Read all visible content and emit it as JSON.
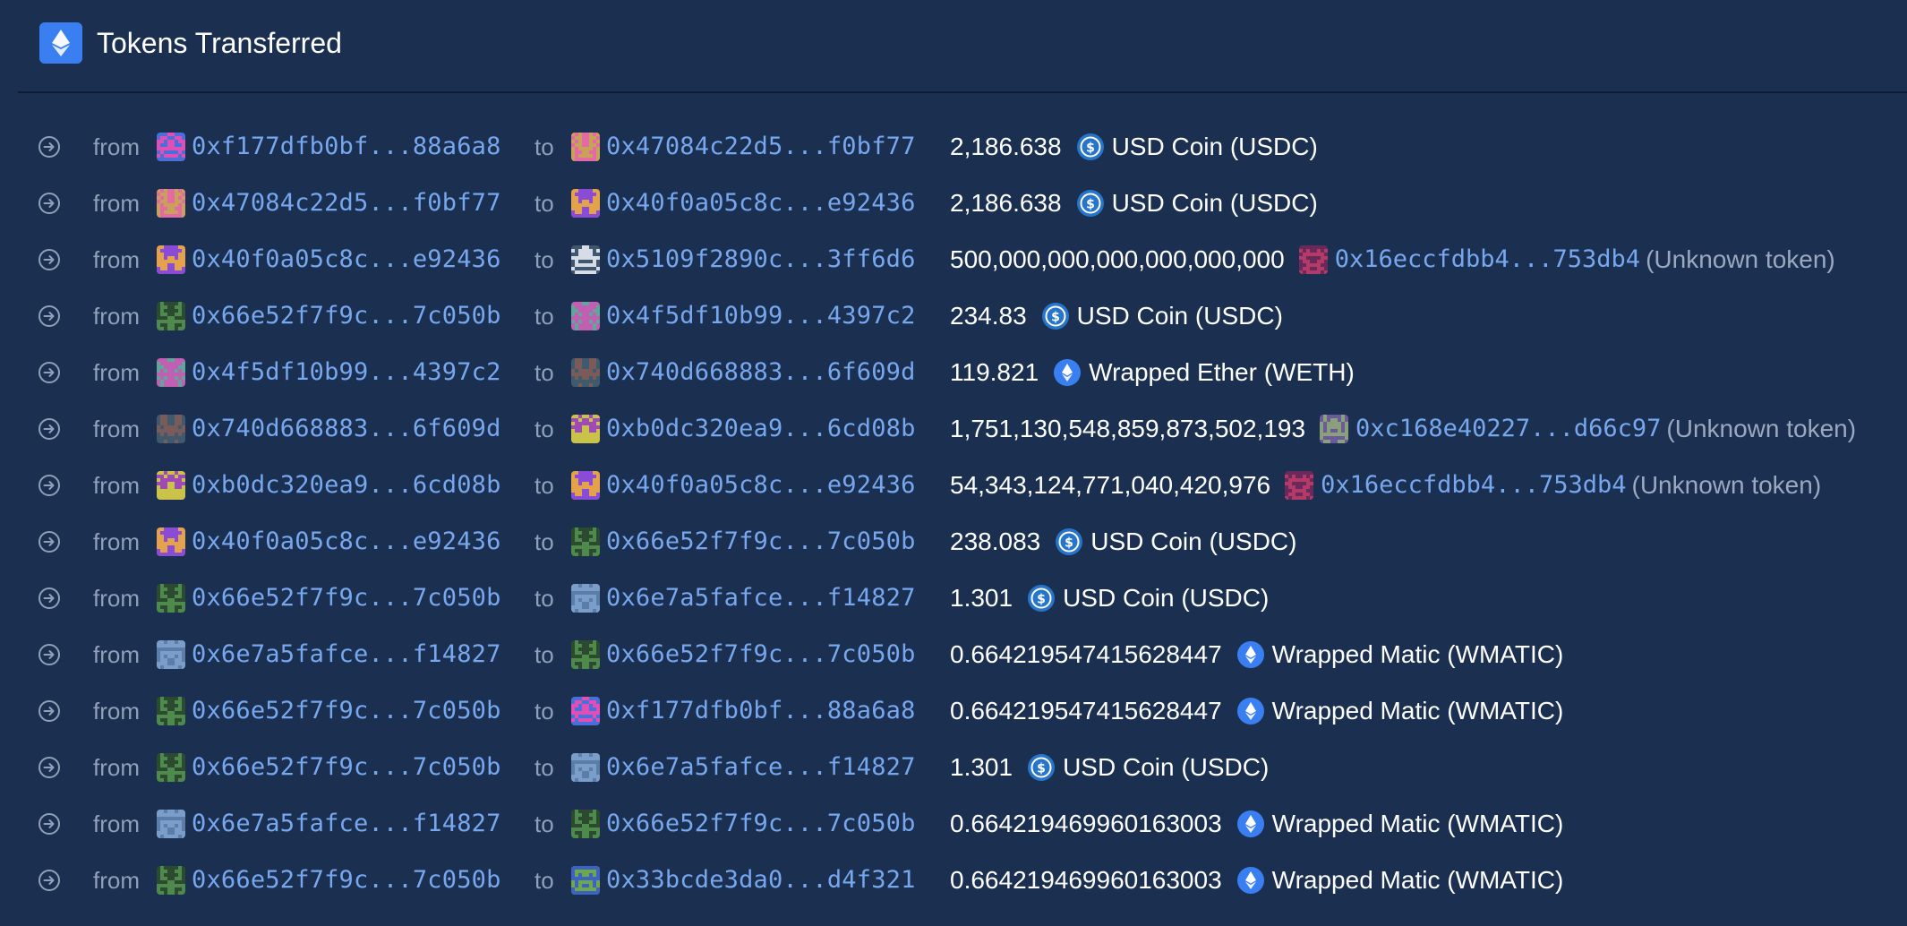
{
  "header": {
    "title": "Tokens Transferred",
    "icon": "ethereum-icon",
    "accent": "#3a7ff2"
  },
  "labels": {
    "from": "from",
    "to": "to"
  },
  "transfers": [
    {
      "from": "0xf177dfb0bf...88a6a8",
      "from_av": "magenta",
      "to": "0x47084c22d5...f0bf77",
      "to_av": "pink",
      "amount": "2,186.638",
      "token": {
        "type": "usdc",
        "name": "USD Coin (USDC)"
      }
    },
    {
      "from": "0x47084c22d5...f0bf77",
      "from_av": "pink",
      "to": "0x40f0a05c8c...e92436",
      "to_av": "purple",
      "amount": "2,186.638",
      "token": {
        "type": "usdc",
        "name": "USD Coin (USDC)"
      }
    },
    {
      "from": "0x40f0a05c8c...e92436",
      "from_av": "purple",
      "to": "0x5109f2890c...3ff6d6",
      "to_av": "white",
      "amount": "500,000,000,000,000,000,000",
      "token": {
        "type": "unknown",
        "address": "0x16eccfdbb4...753db4",
        "suffix": "(Unknown token)",
        "av": "crimson"
      }
    },
    {
      "from": "0x66e52f7f9c...7c050b",
      "from_av": "green",
      "to": "0x4f5df10b99...4397c2",
      "to_av": "teal",
      "amount": "234.83",
      "token": {
        "type": "usdc",
        "name": "USD Coin (USDC)"
      }
    },
    {
      "from": "0x4f5df10b99...4397c2",
      "from_av": "teal",
      "to": "0x740d668883...6f609d",
      "to_av": "brown",
      "amount": "119.821",
      "token": {
        "type": "eth",
        "name": "Wrapped Ether (WETH)"
      }
    },
    {
      "from": "0x740d668883...6f609d",
      "from_av": "brown",
      "to": "0xb0dc320ea9...6cd08b",
      "to_av": "yellow",
      "amount": "1,751,130,548,859,873,502,193",
      "token": {
        "type": "unknown",
        "address": "0xc168e40227...d66c97",
        "suffix": "(Unknown token)",
        "av": "olive"
      }
    },
    {
      "from": "0xb0dc320ea9...6cd08b",
      "from_av": "yellow",
      "to": "0x40f0a05c8c...e92436",
      "to_av": "purple",
      "amount": "54,343,124,771,040,420,976",
      "token": {
        "type": "unknown",
        "address": "0x16eccfdbb4...753db4",
        "suffix": "(Unknown token)",
        "av": "crimson"
      }
    },
    {
      "from": "0x40f0a05c8c...e92436",
      "from_av": "purple",
      "to": "0x66e52f7f9c...7c050b",
      "to_av": "green",
      "amount": "238.083",
      "token": {
        "type": "usdc",
        "name": "USD Coin (USDC)"
      }
    },
    {
      "from": "0x66e52f7f9c...7c050b",
      "from_av": "green",
      "to": "0x6e7a5fafce...f14827",
      "to_av": "slate",
      "amount": "1.301",
      "token": {
        "type": "usdc",
        "name": "USD Coin (USDC)"
      }
    },
    {
      "from": "0x6e7a5fafce...f14827",
      "from_av": "slate",
      "to": "0x66e52f7f9c...7c050b",
      "to_av": "green",
      "amount": "0.664219547415628447",
      "token": {
        "type": "eth",
        "name": "Wrapped Matic (WMATIC)"
      }
    },
    {
      "from": "0x66e52f7f9c...7c050b",
      "from_av": "green",
      "to": "0xf177dfb0bf...88a6a8",
      "to_av": "magenta",
      "amount": "0.664219547415628447",
      "token": {
        "type": "eth",
        "name": "Wrapped Matic (WMATIC)"
      }
    },
    {
      "from": "0x66e52f7f9c...7c050b",
      "from_av": "green",
      "to": "0x6e7a5fafce...f14827",
      "to_av": "slate",
      "amount": "1.301",
      "token": {
        "type": "usdc",
        "name": "USD Coin (USDC)"
      }
    },
    {
      "from": "0x6e7a5fafce...f14827",
      "from_av": "slate",
      "to": "0x66e52f7f9c...7c050b",
      "to_av": "green",
      "amount": "0.664219469960163003",
      "token": {
        "type": "eth",
        "name": "Wrapped Matic (WMATIC)"
      }
    },
    {
      "from": "0x66e52f7f9c...7c050b",
      "from_av": "green",
      "to": "0x33bcde3da0...d4f321",
      "to_av": "blue",
      "amount": "0.664219469960163003",
      "token": {
        "type": "eth",
        "name": "Wrapped Matic (WMATIC)"
      }
    }
  ],
  "avatar_palettes": {
    "magenta": [
      "#e04fb7",
      "#4a6fd8"
    ],
    "pink": [
      "#e36aa4",
      "#c9a25a"
    ],
    "purple": [
      "#8a4bd6",
      "#e3a24b"
    ],
    "white": [
      "#d7dde6",
      "#41566f"
    ],
    "green": [
      "#4d8a4c",
      "#2c4a2f"
    ],
    "teal": [
      "#5fa79d",
      "#c25fb2"
    ],
    "brown": [
      "#7b5a5a",
      "#3f5a6c"
    ],
    "yellow": [
      "#c9c34a",
      "#a04ab8"
    ],
    "slate": [
      "#7a9ec9",
      "#5a7ea7"
    ],
    "blue": [
      "#3c63c4",
      "#6fa84a"
    ],
    "crimson": [
      "#b43a6a",
      "#6a2a59"
    ],
    "olive": [
      "#8aa07a",
      "#6b5a9a"
    ]
  }
}
